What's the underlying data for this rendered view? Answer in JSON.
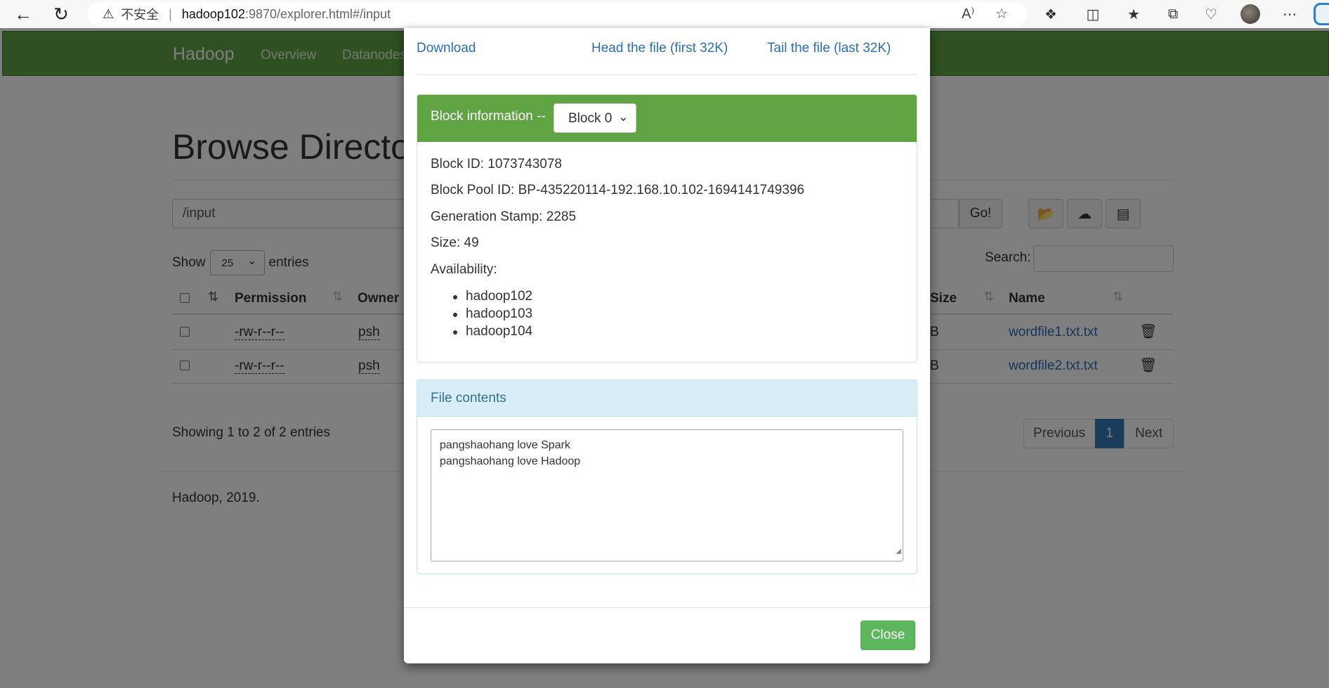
{
  "browser": {
    "insecure_label": "不安全",
    "url_host": "hadoop102",
    "url_path": ":9870/explorer.html#/input",
    "icons": [
      "back-icon",
      "refresh-icon",
      "warning-icon",
      "read-aloud-icon",
      "favorite-star-icon",
      "extensions-icon",
      "split-screen-icon",
      "favorites-icon",
      "collections-icon",
      "browser-essentials-icon",
      "profile-avatar-icon",
      "more-icon"
    ]
  },
  "navbar": {
    "brand": "Hadoop",
    "items": [
      "Overview",
      "Datanodes"
    ]
  },
  "page": {
    "title": "Browse Directory",
    "path_value": "/input",
    "go_label": "Go!",
    "show_label": "Show",
    "entries_select": "25",
    "entries_label": "entries",
    "search_label": "Search:",
    "columns": [
      "Permission",
      "Owner",
      "Size",
      "Name"
    ],
    "rows": [
      {
        "permission": "-rw-r--r--",
        "owner": "psh",
        "size": "B",
        "name": "wordfile1.txt.txt"
      },
      {
        "permission": "-rw-r--r--",
        "owner": "psh",
        "size": "B",
        "name": "wordfile2.txt.txt"
      }
    ],
    "showing": "Showing 1 to 2 of 2 entries",
    "pager": {
      "prev": "Previous",
      "current": "1",
      "next": "Next"
    },
    "footer": "Hadoop, 2019."
  },
  "modal": {
    "download": "Download",
    "head": "Head the file (first 32K)",
    "tail": "Tail the file (last 32K)",
    "block_info_label": "Block information --",
    "block_select": "Block 0",
    "block_id": "Block ID: 1073743078",
    "block_pool_id": "Block Pool ID: BP-435220114-192.168.10.102-1694141749396",
    "generation_stamp": "Generation Stamp: 2285",
    "size": "Size: 49",
    "availability_label": "Availability:",
    "availability": [
      "hadoop102",
      "hadoop103",
      "hadoop104"
    ],
    "file_contents_label": "File contents",
    "file_contents": "pangshaohang love Spark\npangshaohang love Hadoop",
    "close": "Close"
  },
  "colors": {
    "navbar_green": "#5fa343",
    "link_blue": "#2a6fb6",
    "info_bg": "#d9edf7",
    "close_green": "#5cb85c",
    "pager_active": "#337ab7"
  }
}
